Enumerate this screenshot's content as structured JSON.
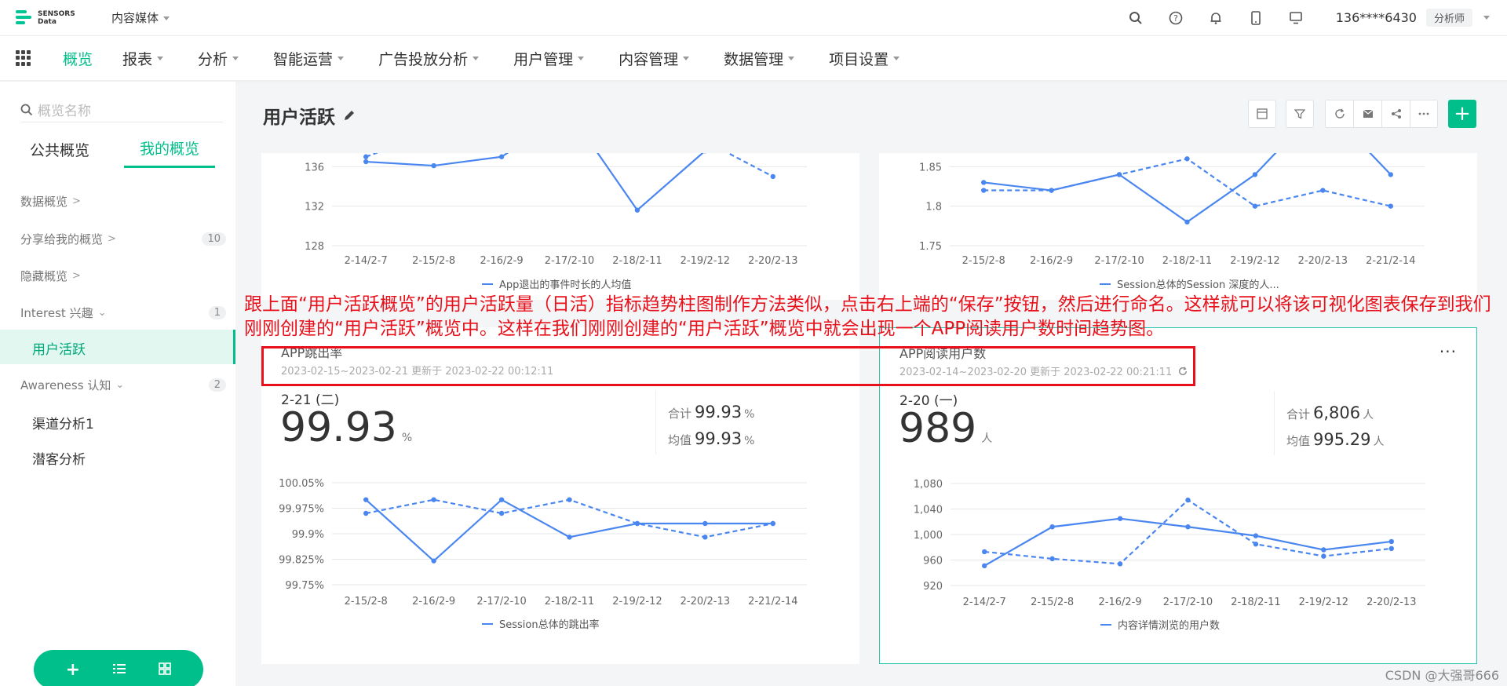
{
  "header": {
    "logo_line1": "SENSORS",
    "logo_line2": "Data",
    "project": "内容媒体",
    "icons": [
      "search-icon",
      "help-icon",
      "bell-icon",
      "mobile-icon",
      "monitor-icon"
    ],
    "user": "136****6430",
    "role": "分析师"
  },
  "nav": {
    "items": [
      "概览",
      "报表",
      "分析",
      "智能运营",
      "广告投放分析",
      "用户管理",
      "内容管理",
      "数据管理",
      "项目设置"
    ],
    "active": "概览",
    "accent": "#00bf8a"
  },
  "sidebar": {
    "search_placeholder": "概览名称",
    "tabs": [
      "公共概览",
      "我的概览"
    ],
    "groups": {
      "data": "数据概览",
      "shared": "分享给我的概览",
      "shared_count": "10",
      "hidden": "隐藏概览",
      "interest": "Interest 兴趣",
      "interest_count": "1",
      "awareness": "Awareness 认知",
      "awareness_count": "2"
    },
    "active_item": "用户活跃",
    "leaf1": "渠道分析1",
    "leaf2": "潜客分析"
  },
  "page": {
    "title": "用户活跃"
  },
  "cards": {
    "top_left_legend": "App退出的事件时长的人均值",
    "top_right_legend": "Session总体的Session 深度的人...",
    "bounce": {
      "title": "APP跳出率",
      "subtitle": "2023-02-15~2023-02-21 更新于 2023-02-22 00:12:11",
      "date": "2-21 (二)",
      "value": "99.93",
      "unit": "%",
      "sum_label": "合计",
      "sum_value": "99.93",
      "avg_label": "均值",
      "avg_value": "99.93",
      "legend": "Session总体的跳出率"
    },
    "readers": {
      "title": "APP阅读用户数",
      "subtitle": "2023-02-14~2023-02-20 更新于 2023-02-22 00:21:11",
      "date": "2-20 (一)",
      "value": "989",
      "unit": "人",
      "sum_label": "合计",
      "sum_value": "6,806",
      "avg_label": "均值",
      "avg_value": "995.29",
      "legend": "内容详情浏览的用户数"
    }
  },
  "annotation": "跟上面“用户活跃概览”的用户活跃量（日活）指标趋势柱图制作方法类似，点击右上端的“保存”按钮，然后进行命名。这样就可以将该可视化图表保存到我们刚刚创建的“用户活跃”概览中。这样在我们刚刚创建的“用户活跃”概览中就会出现一个APP阅读用户数时间趋势图。",
  "watermark": "CSDN @大强哥666",
  "chart_data": [
    {
      "type": "line",
      "x": [
        "2-14/2-7",
        "2-15/2-8",
        "2-16/2-9",
        "2-17/2-10",
        "2-18/2-11",
        "2-19/2-12",
        "2-20/2-13"
      ],
      "yticks": [
        128,
        132,
        136
      ],
      "ylim": [
        128,
        140
      ],
      "series": [
        {
          "name": "App退出的事件时长的人均值",
          "style": "solid",
          "values": [
            136.5,
            136.1,
            137,
            141.5,
            131.6,
            137.6,
            141
          ]
        },
        {
          "style": "dashed",
          "values": [
            137,
            139.5,
            141,
            139,
            138,
            138.6,
            135
          ]
        }
      ],
      "legend": "bottom",
      "color": "#4a86f0"
    },
    {
      "type": "line",
      "x": [
        "2-15/2-8",
        "2-16/2-9",
        "2-17/2-10",
        "2-18/2-11",
        "2-19/2-12",
        "2-20/2-13",
        "2-21/2-14"
      ],
      "yticks": [
        1.75,
        1.8,
        1.85
      ],
      "ylim": [
        1.75,
        1.9
      ],
      "series": [
        {
          "name": "Session总体的Session 深度的人...",
          "style": "solid",
          "values": [
            1.83,
            1.82,
            1.84,
            1.78,
            1.84,
            1.93,
            1.84
          ]
        },
        {
          "style": "dashed",
          "values": [
            1.82,
            1.82,
            1.84,
            1.86,
            1.8,
            1.82,
            1.8
          ]
        }
      ],
      "legend": "bottom",
      "color": "#4a86f0"
    },
    {
      "type": "line",
      "title": "APP跳出率",
      "x": [
        "2-15/2-8",
        "2-16/2-9",
        "2-17/2-10",
        "2-18/2-11",
        "2-19/2-12",
        "2-20/2-13",
        "2-21/2-14"
      ],
      "yticks": [
        "99.75%",
        "99.825%",
        "99.9%",
        "99.975%",
        "100.05%"
      ],
      "ylim": [
        99.75,
        100.05
      ],
      "series": [
        {
          "name": "Session总体的跳出率",
          "style": "solid",
          "values": [
            100.0,
            99.82,
            100.0,
            99.89,
            99.93,
            99.93,
            99.93
          ]
        },
        {
          "style": "dashed",
          "values": [
            99.96,
            100.0,
            99.96,
            100.0,
            99.93,
            99.89,
            99.93
          ]
        }
      ],
      "legend": "bottom",
      "color": "#4a86f0"
    },
    {
      "type": "line",
      "title": "APP阅读用户数",
      "x": [
        "2-14/2-7",
        "2-15/2-8",
        "2-16/2-9",
        "2-17/2-10",
        "2-18/2-11",
        "2-19/2-12",
        "2-20/2-13"
      ],
      "yticks": [
        "920",
        "960",
        "1,000",
        "1,040",
        "1,080"
      ],
      "ylim": [
        920,
        1080
      ],
      "series": [
        {
          "name": "内容详情浏览的用户数",
          "style": "solid",
          "values": [
            951,
            1012,
            1025,
            1012,
            998,
            976,
            989
          ]
        },
        {
          "style": "dashed",
          "values": [
            973,
            962,
            954,
            1054,
            985,
            966,
            978
          ]
        }
      ],
      "legend": "bottom",
      "color": "#4a86f0"
    }
  ]
}
